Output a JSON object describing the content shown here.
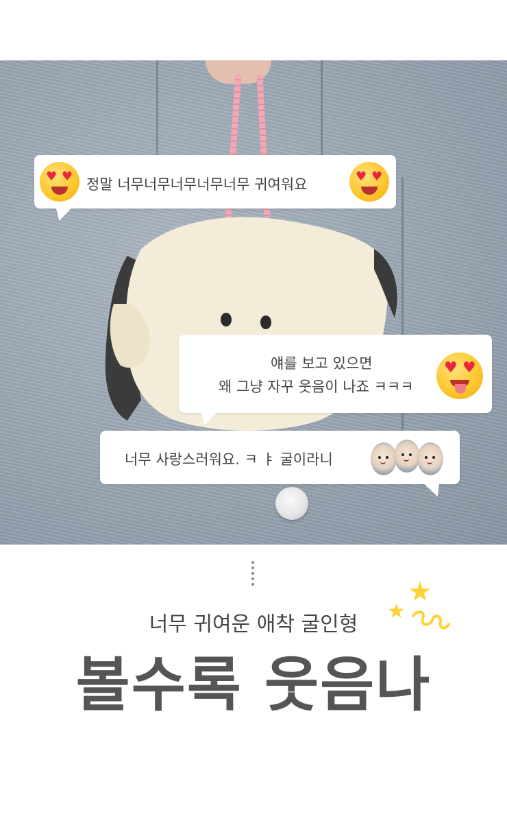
{
  "bubbles": {
    "first": "정말 너무너무너무너무너무 귀여워요",
    "second_line1": "얘를 보고 있으면",
    "second_line2": "왜 그냥 자꾸 웃음이 나죠 ㅋㅋㅋ",
    "third": "너무 사랑스러워요. ㅋ ㅑ  굴이라니"
  },
  "bottom": {
    "subtitle": "너무 귀여운 애착 굴인형",
    "title": "볼수록 웃음나"
  },
  "icons": [
    "heart-eyes-emoji",
    "tongue-heart-eyes-emoji",
    "oyster-trio-icon",
    "star-sparkle-icon",
    "vertical-dots-icon"
  ],
  "colors": {
    "accent_yellow": "#ffd23a",
    "text": "#444444",
    "chain_pink": "#f0a9b5"
  }
}
